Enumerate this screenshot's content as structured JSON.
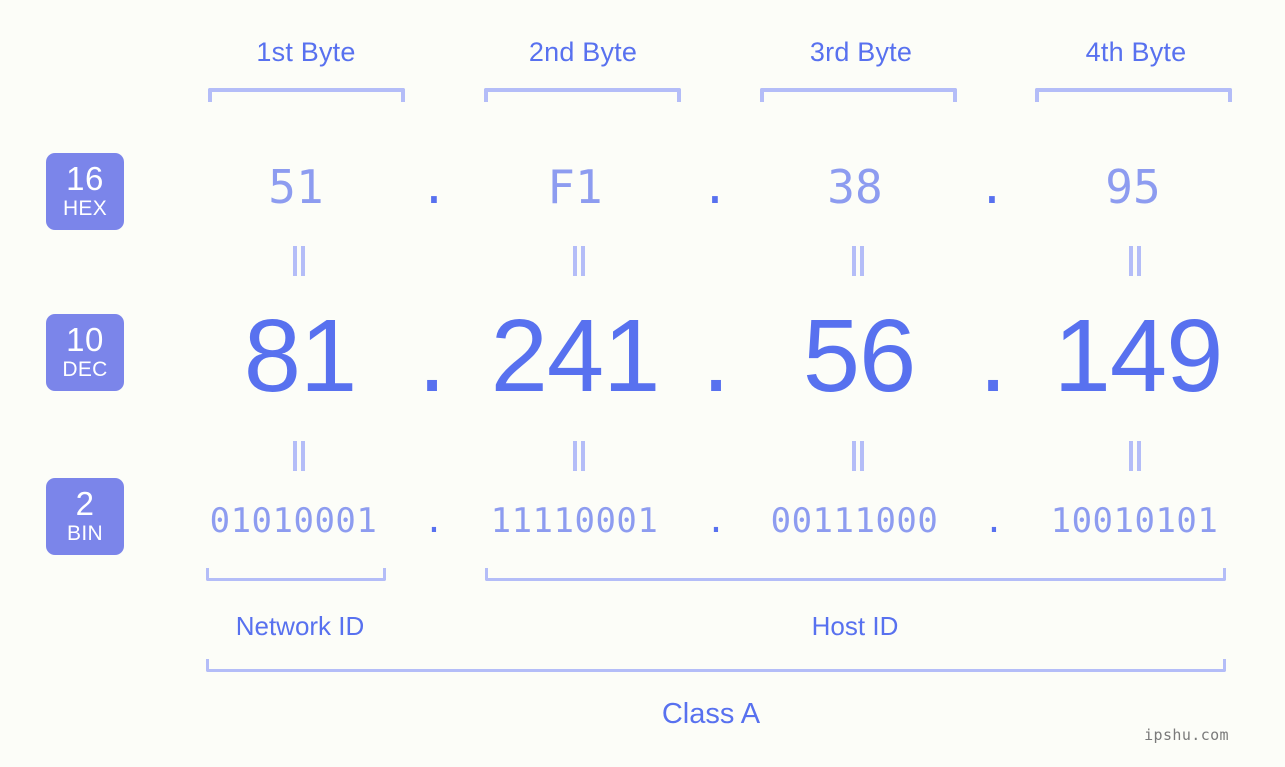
{
  "page": {
    "background_color": "#fcfdf8",
    "accent_color": "#5871ef",
    "light_accent_color": "#8d9cf0",
    "bracket_color": "#b4bdf8",
    "badge_color": "#7b85ea",
    "watermark": "ipshu.com"
  },
  "byte_headers": [
    {
      "label": "1st Byte"
    },
    {
      "label": "2nd Byte"
    },
    {
      "label": "3rd Byte"
    },
    {
      "label": "4th Byte"
    }
  ],
  "radix_badges": [
    {
      "number": "16",
      "label": "HEX"
    },
    {
      "number": "10",
      "label": "DEC"
    },
    {
      "number": "2",
      "label": "BIN"
    }
  ],
  "separators": {
    "dot": ".",
    "equals": "||"
  },
  "rows": {
    "hex": {
      "radix": "16",
      "radix_label": "HEX",
      "octets": [
        "51",
        "F1",
        "38",
        "95"
      ]
    },
    "dec": {
      "radix": "10",
      "radix_label": "DEC",
      "octets": [
        "81",
        "241",
        "56",
        "149"
      ]
    },
    "bin": {
      "radix": "2",
      "radix_label": "BIN",
      "octets": [
        "01010001",
        "11110001",
        "00111000",
        "10010101"
      ]
    }
  },
  "segments": {
    "network_id": "Network ID",
    "host_id": "Host ID",
    "address_class": "Class A"
  }
}
